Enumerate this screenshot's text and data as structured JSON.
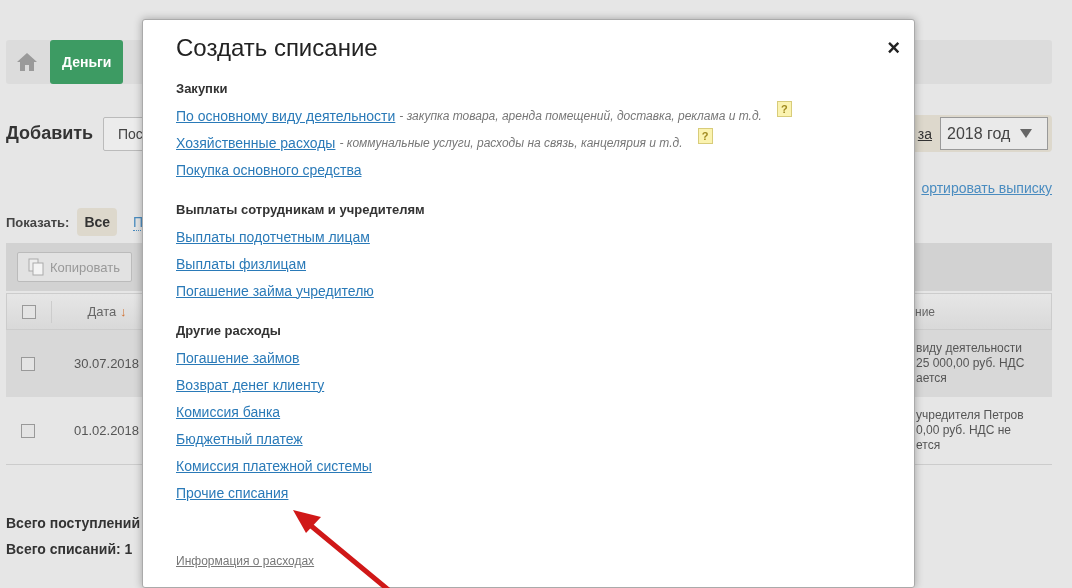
{
  "background": {
    "nav": {
      "active_tab": "Деньги"
    },
    "add_label": "Добавить",
    "add_button": "Пос",
    "period_link": "за",
    "year_select": "2018 год",
    "export_link": "ортировать выписку",
    "show_label": "Показать:",
    "filters": [
      {
        "label": "Все",
        "selected": true
      },
      {
        "label": "П",
        "selected": false
      }
    ],
    "copy_button": "Копировать",
    "table": {
      "select_all_checked": false,
      "columns": [
        {
          "label": "Дата",
          "sort": "↓"
        },
        {
          "label": "ние"
        }
      ],
      "rows": [
        {
          "checked": false,
          "highlighted": true,
          "date": "30.07.2018",
          "description": [
            "виду деятельности",
            "25 000,00 руб. НДС",
            "ается"
          ]
        },
        {
          "checked": false,
          "highlighted": false,
          "date": "01.02.2018",
          "description": [
            "учредителя Петров",
            "0,00 руб. НДС не",
            "ется"
          ]
        }
      ]
    },
    "totals": [
      "Всего поступлений",
      "Всего списаний: 1"
    ]
  },
  "dialog": {
    "title": "Создать списание",
    "close": "×",
    "sections": [
      {
        "heading": "Закупки",
        "links": [
          {
            "label": "По основному виду деятельности",
            "note": "- закупка товара, аренда помещений, доставка, реклама и т.д.",
            "help": "?"
          },
          {
            "label": "Хозяйственные расходы",
            "note": "- коммунальные услуги, расходы на связь, канцелярия и т.д.",
            "help": "?"
          },
          {
            "label": "Покупка основного средства"
          }
        ]
      },
      {
        "heading": "Выплаты сотрудникам и учредителям",
        "links": [
          {
            "label": "Выплаты подотчетным лицам"
          },
          {
            "label": "Выплаты физлицам"
          },
          {
            "label": "Погашение займа учредителю"
          }
        ]
      },
      {
        "heading": "Другие расходы",
        "links": [
          {
            "label": "Погашение займов"
          },
          {
            "label": "Возврат денег клиенту"
          },
          {
            "label": "Комиссия банка"
          },
          {
            "label": "Бюджетный платеж"
          },
          {
            "label": "Комиссия платежной системы"
          },
          {
            "label": "Прочие списания"
          }
        ]
      }
    ],
    "footer_link": "Информация о расходах"
  }
}
